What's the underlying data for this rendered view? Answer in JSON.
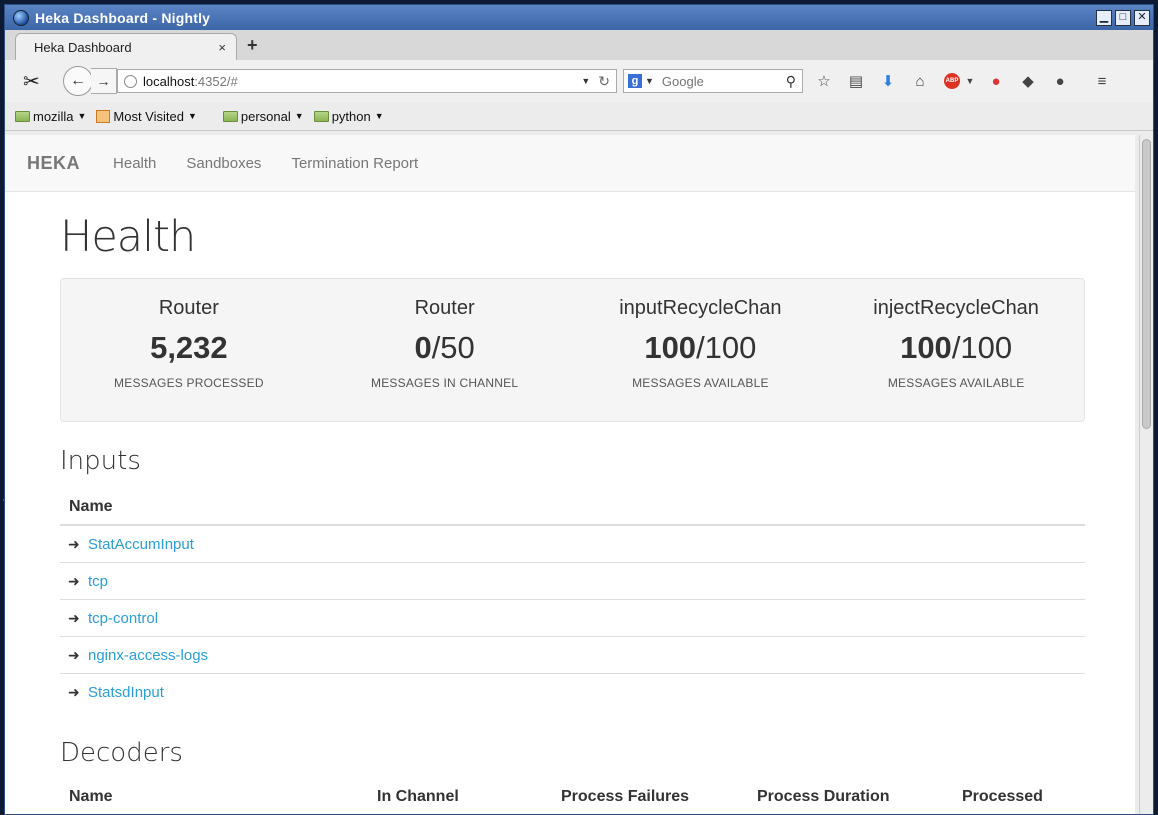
{
  "window": {
    "title": "Heka Dashboard - Nightly"
  },
  "browser": {
    "tab_title": "Heka Dashboard",
    "tab_close": "×",
    "new_tab": "+",
    "url_host": "localhost",
    "url_rest": ":4352/#",
    "search_engine_letter": "g",
    "search_placeholder": "Google",
    "bookmarks": [
      {
        "label": "mozilla"
      },
      {
        "label": "Most Visited"
      },
      {
        "label": "personal"
      },
      {
        "label": "python"
      }
    ]
  },
  "app": {
    "brand": "HEKA",
    "nav": [
      "Health",
      "Sandboxes",
      "Termination Report"
    ],
    "page_title": "Health",
    "stats": [
      {
        "label": "Router",
        "value_bold": "5,232",
        "value_rest": "",
        "sub": "MESSAGES PROCESSED"
      },
      {
        "label": "Router",
        "value_bold": "0",
        "value_rest": "/50",
        "sub": "MESSAGES IN CHANNEL"
      },
      {
        "label": "inputRecycleChan",
        "value_bold": "100",
        "value_rest": "/100",
        "sub": "MESSAGES AVAILABLE"
      },
      {
        "label": "injectRecycleChan",
        "value_bold": "100",
        "value_rest": "/100",
        "sub": "MESSAGES AVAILABLE"
      }
    ],
    "inputs": {
      "heading": "Inputs",
      "column": "Name",
      "rows": [
        "StatAccumInput",
        "tcp",
        "tcp-control",
        "nginx-access-logs",
        "StatsdInput"
      ]
    },
    "decoders": {
      "heading": "Decoders",
      "columns": [
        "Name",
        "In Channel",
        "Process Failures",
        "Process Duration",
        "Processed"
      ]
    }
  },
  "colors": {
    "link": "#2a9fd6",
    "titlebar": "#4a74b6"
  }
}
